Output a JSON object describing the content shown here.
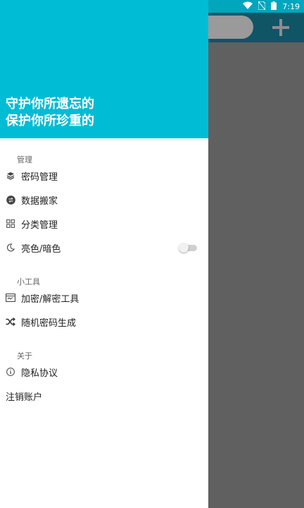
{
  "status_bar": {
    "time": "7:19"
  },
  "drawer": {
    "tagline": [
      "守护你所遗忘的",
      "保护你所珍重的"
    ],
    "sections": [
      {
        "title": "管理",
        "items": [
          {
            "label": "密码管理",
            "icon": "layers-icon"
          },
          {
            "label": "数据搬家",
            "icon": "transfer-icon"
          },
          {
            "label": "分类管理",
            "icon": "grid-icon"
          },
          {
            "label": "亮色/暗色",
            "icon": "moon-icon",
            "toggle": false
          }
        ]
      },
      {
        "title": "小工具",
        "items": [
          {
            "label": "加密/解密工具",
            "icon": "encrypt-tool-icon"
          },
          {
            "label": "随机密码生成",
            "icon": "shuffle-icon"
          }
        ]
      },
      {
        "title": "关于",
        "items": [
          {
            "label": "隐私协议",
            "icon": "info-icon"
          }
        ]
      }
    ],
    "logout": "注销账户"
  },
  "colors": {
    "header": "#00bcd4",
    "status_bar": "#00a5be",
    "scrim": "#606060",
    "toolbar": "#0f5566"
  }
}
